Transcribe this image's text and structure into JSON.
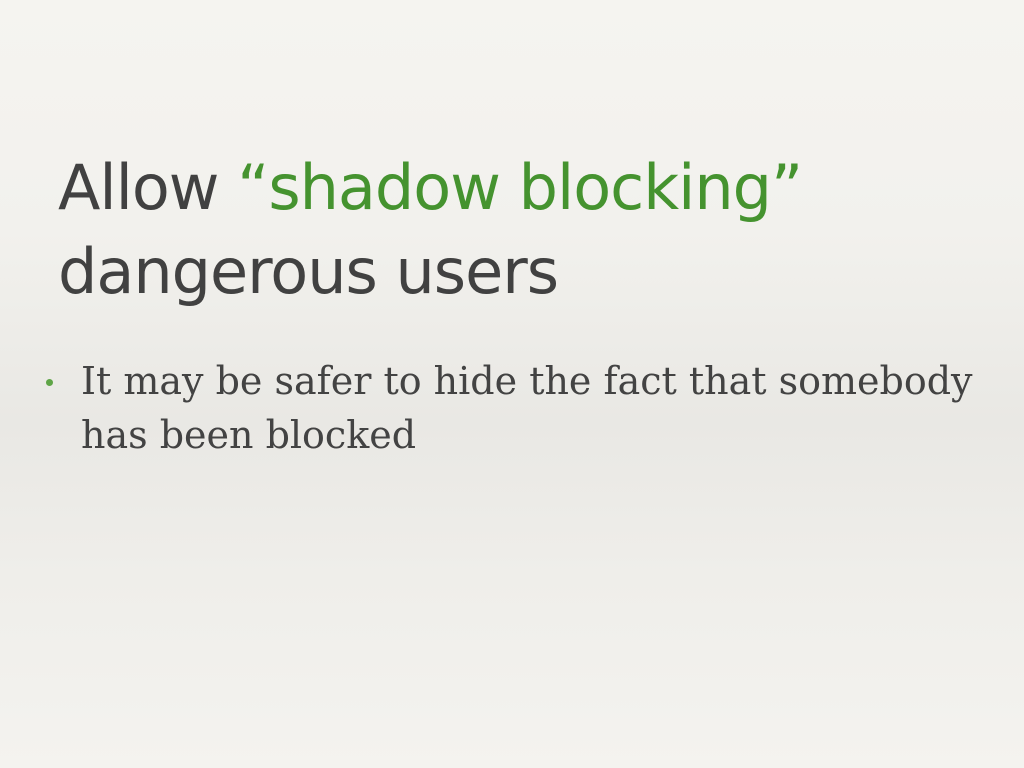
{
  "slide": {
    "title": {
      "prefix": "Allow ",
      "highlight": "“shadow blocking”",
      "suffix": "dangerous users"
    },
    "bullets": [
      {
        "text": "It may be safer to hide the fact that somebody has been blocked"
      }
    ]
  },
  "colors": {
    "title_text": "#414141",
    "title_accent": "#45932f",
    "bullet_text": "#434343",
    "bullet_dot": "#5fa547",
    "background": "#f2f1ed"
  }
}
